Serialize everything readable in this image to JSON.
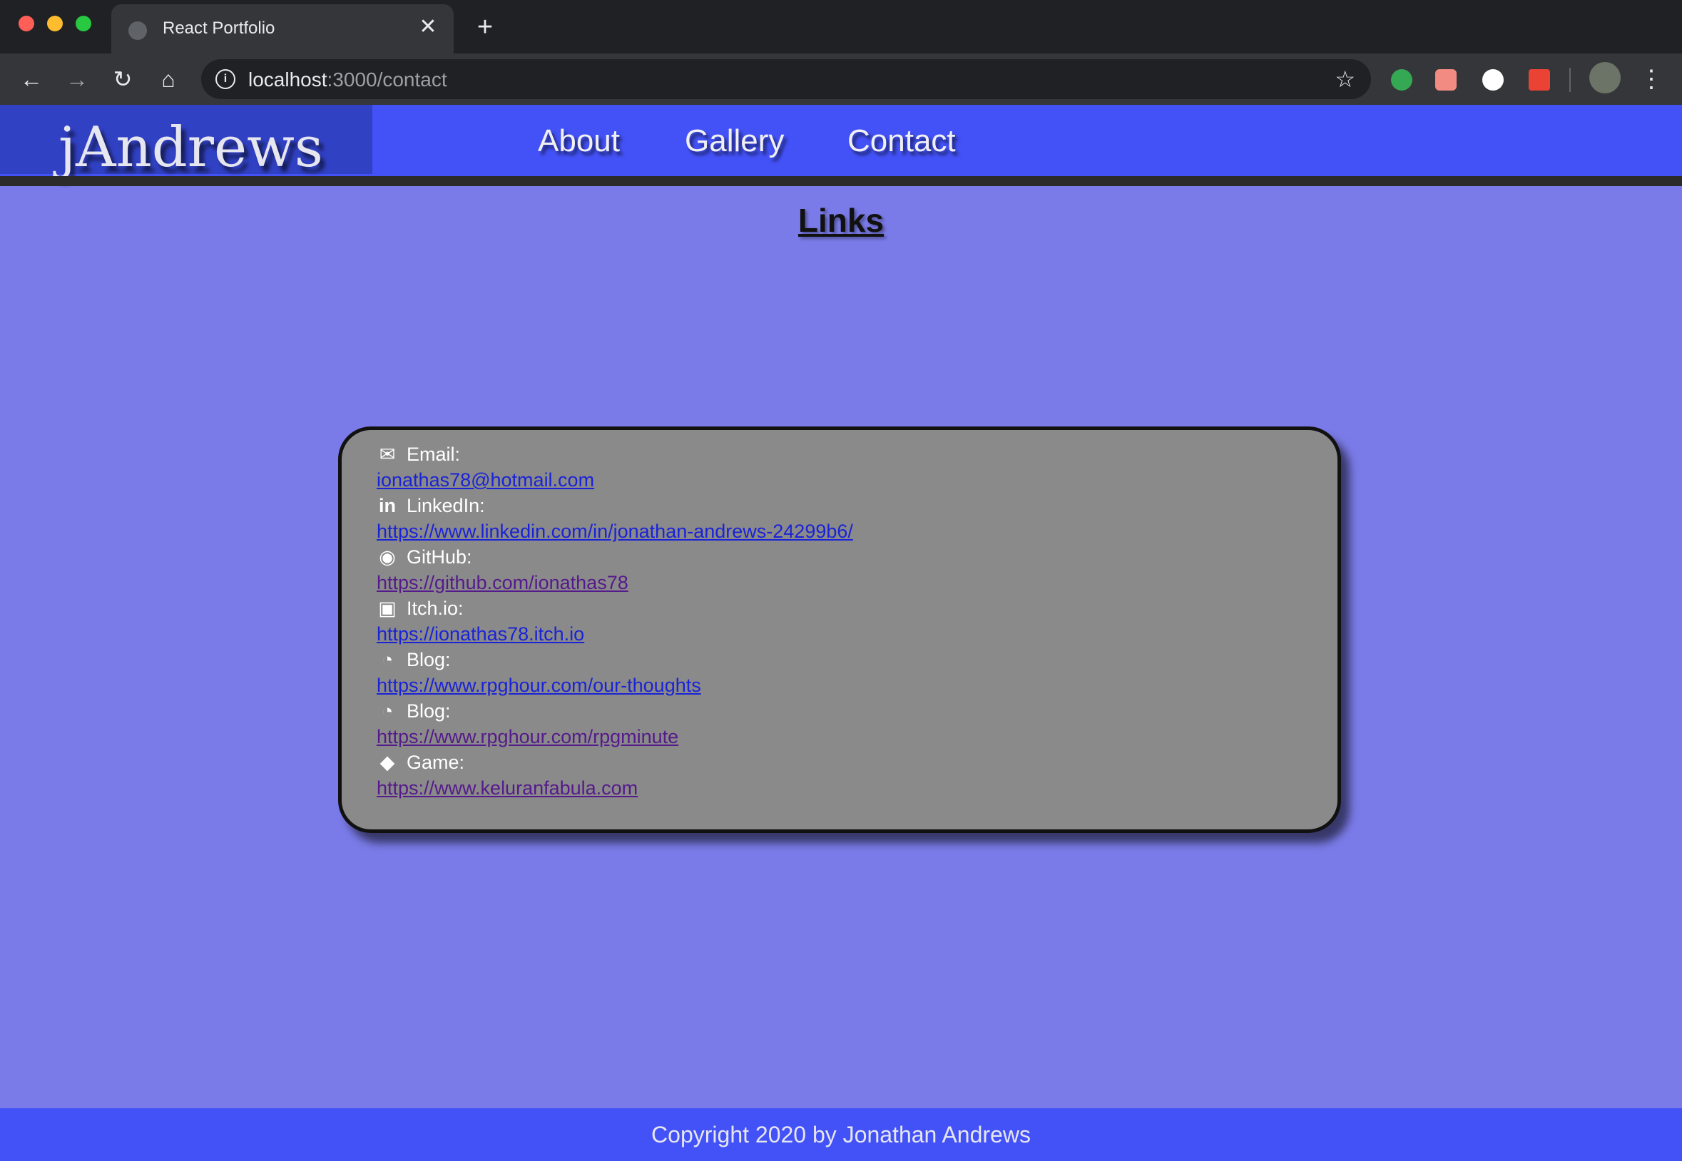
{
  "browser": {
    "tab_title": "React Portfolio",
    "tab_close": "✕",
    "new_tab": "+",
    "url_host": "localhost",
    "url_rest": ":3000/contact",
    "back_icon": "←",
    "forward_icon": "→",
    "reload_icon": "↻",
    "home_icon": "⌂",
    "info_icon": "i",
    "star_icon": "☆",
    "menu_icon": "⋮"
  },
  "site": {
    "logo": "jAndrews",
    "nav": {
      "about": "About",
      "gallery": "Gallery",
      "contact": "Contact"
    }
  },
  "main": {
    "heading": "Links",
    "links": [
      {
        "icon": "envelope-icon",
        "glyph": "✉",
        "label": "Email:",
        "url": "ionathas78@hotmail.com"
      },
      {
        "icon": "linkedin-icon",
        "glyph": "in",
        "label": "LinkedIn:",
        "url": "https://www.linkedin.com/in/jonathan-andrews-24299b6/"
      },
      {
        "icon": "github-icon",
        "glyph": "◉",
        "label": "GitHub:",
        "url": "https://github.com/ionathas78"
      },
      {
        "icon": "itchio-icon",
        "glyph": "▣",
        "label": "Itch.io:",
        "url": "https://ionathas78.itch.io"
      },
      {
        "icon": "blog-icon",
        "glyph": "◔",
        "label": "Blog:",
        "url": "https://www.rpghour.com/our-thoughts"
      },
      {
        "icon": "blog-icon",
        "glyph": "◔",
        "label": "Blog:",
        "url": "https://www.rpghour.com/rpgminute"
      },
      {
        "icon": "cube-icon",
        "glyph": "◆",
        "label": "Game:",
        "url": "https://www.keluranfabula.com"
      }
    ]
  },
  "footer": {
    "text": "Copyright 2020 by Jonathan Andrews"
  },
  "colors": {
    "page_bg": "#7a7be8",
    "header_bg": "#4352f7",
    "logo_bg": "#3141c4",
    "card_bg": "#8a8a8a",
    "link": "#1a23d6",
    "visited_link": "#551a8b"
  }
}
